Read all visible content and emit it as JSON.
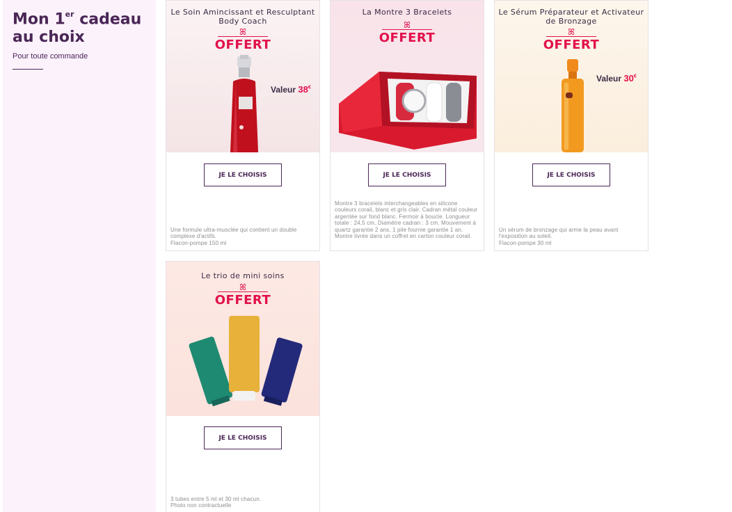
{
  "sidebar": {
    "title_line1_a": "Mon 1",
    "title_sup": "er",
    "title_line1_b": " cadeau",
    "title_line2": "au choix",
    "subtitle": "Pour toute commande"
  },
  "badge_word": "OFFERT",
  "button_label": "JE LE CHOISIS",
  "colors": {
    "brand_purple": "#4a2656",
    "offer_pink": "#e2104b",
    "sidebar_bg": "#fbf2fc"
  },
  "cards": [
    {
      "title": "Le Soin Amincissant et Resculptant Body Coach",
      "valeur_label": "Valeur",
      "valeur_price": "38",
      "valeur_currency": "€",
      "description": "Une formule ultra-musclée qui contient un double complexe d'actifs.\nFlacon-pompe 150 ml",
      "icon": "serum-bottle-icon"
    },
    {
      "title": "La Montre 3 Bracelets",
      "description": "Montre 3 bracelets interchangeables en silicone couleurs corail, blanc et gris clair. Cadran métal couleur argentée sur fond blanc. Fermoir à boucle. Longueur totale : 24,5 cm. Diamètre cadran : 3 cm. Mouvement à quartz garantie 2 ans, 1 pile fournie garantie 1 an. Montre livrée dans un coffret en carton couleur corail.",
      "icon": "watch-box-icon"
    },
    {
      "title": "Le Sérum Préparateur et Activateur de Bronzage",
      "valeur_label": "Valeur",
      "valeur_price": "30",
      "valeur_currency": "€",
      "description": "Un sérum de bronzage qui arme la peau avant l'exposition au soleil.\nFlacon-pompe 30 ml",
      "icon": "orange-bottle-icon"
    },
    {
      "title": "Le trio de mini soins",
      "description": "3 tubes entre 5 ml et 30 ml chacun.\nPhoto non contractuelle",
      "icon": "three-tubes-icon"
    }
  ]
}
